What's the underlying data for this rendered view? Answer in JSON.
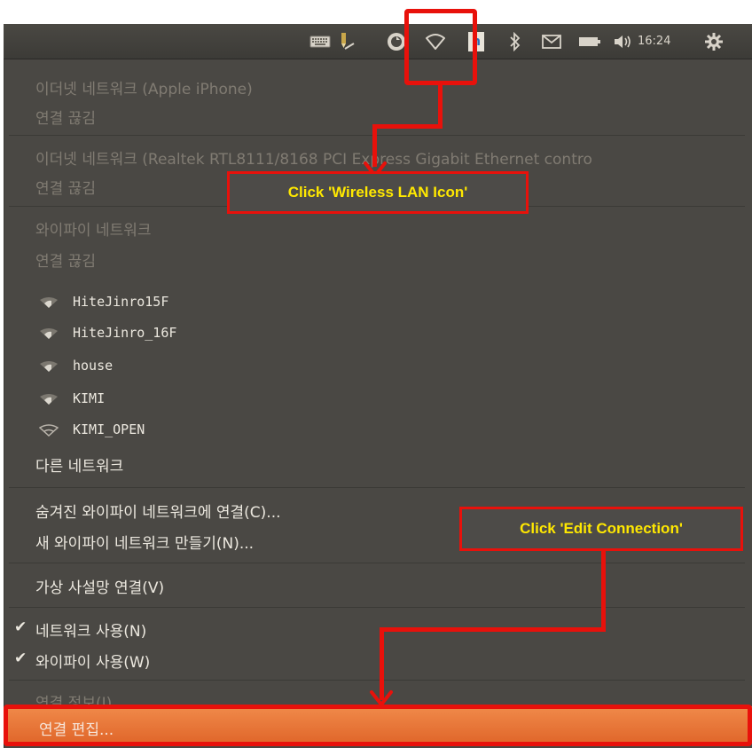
{
  "panel": {
    "clock": "16:24",
    "indicators": [
      "keyboard-icon",
      "pen-icon",
      "update-icon",
      "wireless-icon",
      "input-method-icon",
      "bluetooth-icon",
      "mail-icon",
      "battery-icon",
      "volume-icon",
      "gear-icon"
    ],
    "input_method_label": "n"
  },
  "menu": {
    "ethernet1_header": "이더넷 네트워크 (Apple iPhone)",
    "ethernet1_status": "연결 끊김",
    "ethernet2_header": "이더넷 네트워크 (Realtek RTL8111/8168 PCI Express Gigabit Ethernet contro",
    "ethernet2_status": "연결 끊김",
    "wifi_header": "와이파이 네트워크",
    "wifi_status": "연결 끊김",
    "networks": [
      {
        "name": "HiteJinro15F"
      },
      {
        "name": "HiteJinro_16F"
      },
      {
        "name": "house"
      },
      {
        "name": "KIMI"
      },
      {
        "name": "KIMI_OPEN"
      }
    ],
    "other_networks": "다른 네트워크",
    "connect_hidden": "숨겨진 와이파이 네트워크에 연결(C)...",
    "create_new": "새 와이파이 네트워크 만들기(N)...",
    "vpn": "가상 사설망 연결(V)",
    "enable_networking": "네트워크 사용(N)",
    "enable_wifi": "와이파이 사용(W)",
    "check_mark": "✔",
    "connection_info": "연결 정보(I)",
    "edit_connections": "연결 편집..."
  },
  "annotations": {
    "callout1": "Click 'Wireless LAN Icon'",
    "callout2": "Click 'Edit Connection'",
    "color": "#e8110b",
    "callout_text_color": "#ffe800"
  }
}
